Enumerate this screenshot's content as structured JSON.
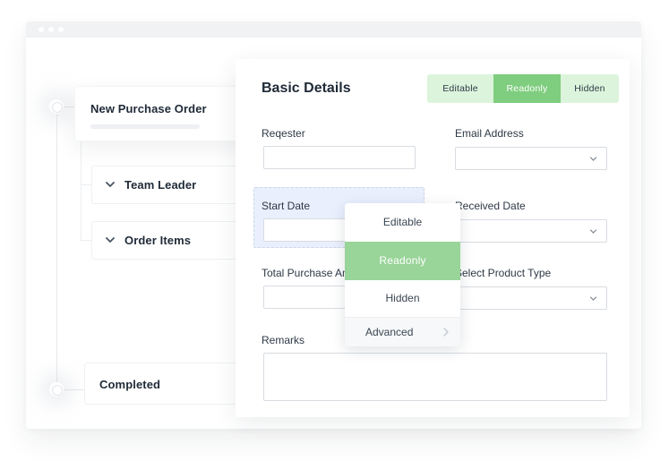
{
  "window": {
    "title_dots": 3
  },
  "workflow": {
    "stages": [
      {
        "label": "New Purchase Order",
        "active": true
      },
      {
        "label": "Team Leader",
        "collapsed": true
      },
      {
        "label": "Order Items",
        "collapsed": true
      },
      {
        "label": "Completed"
      }
    ]
  },
  "panel": {
    "title": "Basic Details",
    "mode_toggle": {
      "options": [
        "Editable",
        "Readonly",
        "Hidden"
      ],
      "selected": "Readonly"
    },
    "fields": {
      "requester": {
        "label": "Reqester",
        "value": ""
      },
      "email": {
        "label": "Email Address",
        "value": ""
      },
      "start_date": {
        "label": "Start Date",
        "value": ""
      },
      "received_date": {
        "label": "Received Date",
        "value": ""
      },
      "total_purchase": {
        "label": "Total Purchase Amount",
        "visible_label": "Total Purchase A",
        "value": ""
      },
      "product_type": {
        "label": "Select Product Type",
        "value": ""
      },
      "remarks": {
        "label": "Remarks",
        "value": ""
      }
    }
  },
  "field_menu": {
    "items": [
      "Editable",
      "Readonly",
      "Hidden"
    ],
    "selected": "Readonly",
    "advanced_label": "Advanced"
  },
  "colors": {
    "accent_green": "#7fcd7f",
    "menu_selected_green": "#99d499",
    "toggle_bg_green": "#dcf4dc",
    "highlight_blue": "#e9effd",
    "text_dark": "#1f2a37"
  }
}
